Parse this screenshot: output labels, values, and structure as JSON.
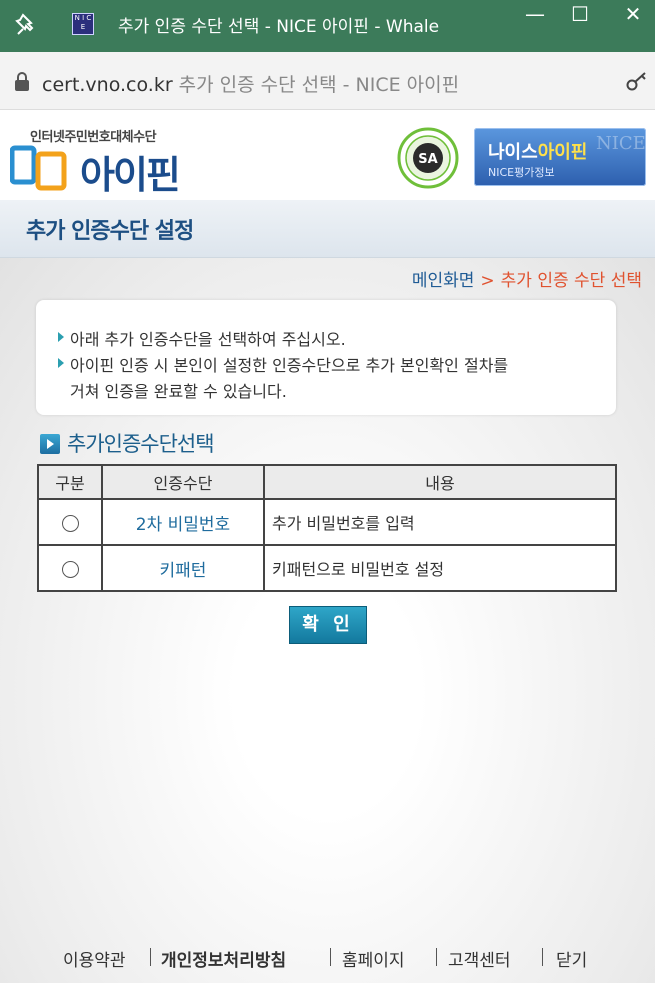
{
  "window": {
    "title": "추가 인증 수단 선택 - NICE 아이핀 - Whale",
    "favicon_text": "N I C E",
    "minimize": "—",
    "maximize": "☐",
    "close": "✕"
  },
  "address_bar": {
    "host": "cert.vno.co.kr",
    "page_title": "추가 인증 수단 선택 - NICE 아이핀"
  },
  "header": {
    "logo_small": "인터넷주민번호대체수단",
    "logo_big": "아이핀",
    "badge_text": "SA",
    "nice_logo_main": "나이스",
    "nice_logo_highlight": "아이핀",
    "nice_logo_sub": "NICE평가정보",
    "nice_logo_ghost": "NICE"
  },
  "subheader": {
    "title": "추가 인증수단 설정"
  },
  "breadcrumb": {
    "home": "메인화면",
    "separator": ">",
    "current": "추가 인증 수단 선택"
  },
  "notice": {
    "lines": [
      "아래 추가 인증수단을 선택하여 주십시오.",
      "아이핀 인증 시 본인이 설정한 인증수단으로 추가 본인확인 절차를",
      "거쳐 인증을 완료할 수 있습니다."
    ]
  },
  "section": {
    "title": "추가인증수단선택"
  },
  "table": {
    "headers": [
      "구분",
      "인증수단",
      "내용"
    ],
    "rows": [
      {
        "method": "2차 비밀번호",
        "description": "추가 비밀번호를 입력"
      },
      {
        "method": "키패턴",
        "description": "키패턴으로 비밀번호 설정"
      }
    ]
  },
  "confirm_button": "확 인",
  "footer": {
    "links": [
      "이용약관",
      "개인정보처리방침",
      "홈페이지",
      "고객센터",
      "닫기"
    ]
  },
  "colors": {
    "titlebar": "#3c7b5a",
    "accent_blue": "#1f6c9e",
    "accent_orange": "#e0522f"
  }
}
